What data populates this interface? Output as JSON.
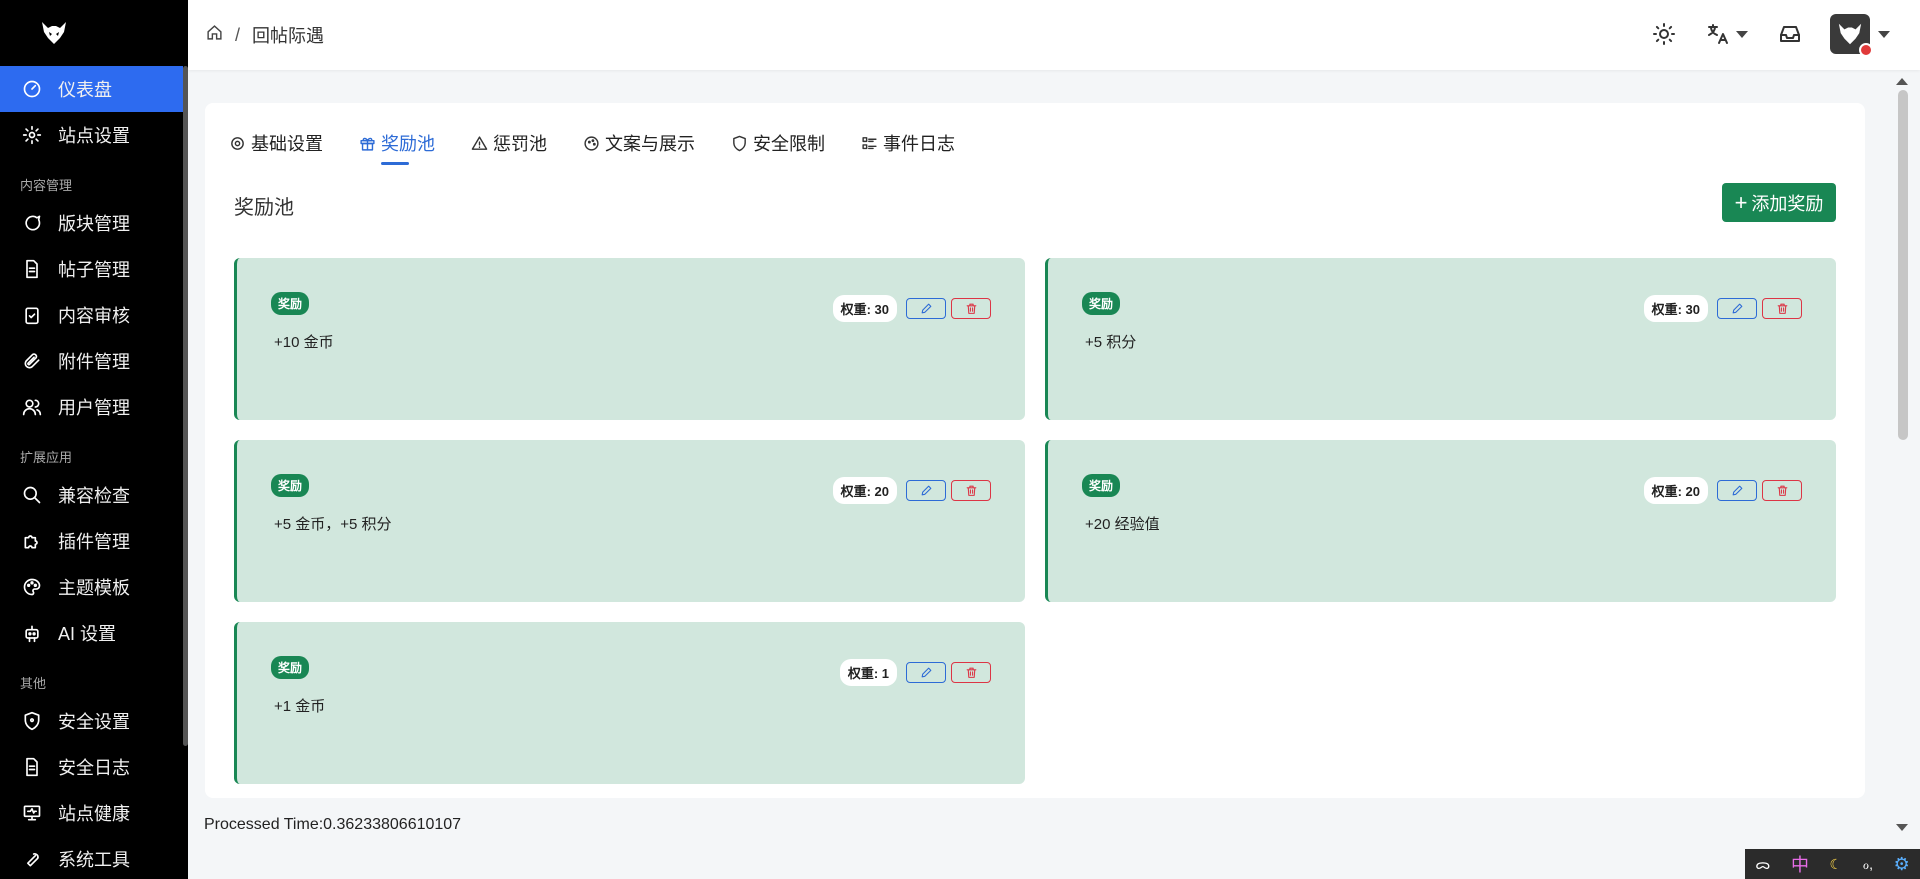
{
  "sidebar": {
    "items_top": [
      {
        "label": "仪表盘",
        "icon": "dashboard-icon",
        "active": true
      },
      {
        "label": "站点设置",
        "icon": "gear-icon",
        "active": false
      }
    ],
    "section_content": "内容管理",
    "items_content": [
      {
        "label": "版块管理",
        "icon": "chat-bubble-icon"
      },
      {
        "label": "帖子管理",
        "icon": "document-icon"
      },
      {
        "label": "内容审核",
        "icon": "clipboard-check-icon"
      },
      {
        "label": "附件管理",
        "icon": "paperclip-icon"
      },
      {
        "label": "用户管理",
        "icon": "users-icon"
      }
    ],
    "section_ext": "扩展应用",
    "items_ext": [
      {
        "label": "兼容检查",
        "icon": "search-icon"
      },
      {
        "label": "插件管理",
        "icon": "puzzle-icon"
      },
      {
        "label": "主题模板",
        "icon": "palette-icon"
      },
      {
        "label": "AI 设置",
        "icon": "robot-icon"
      }
    ],
    "section_other": "其他",
    "items_other": [
      {
        "label": "安全设置",
        "icon": "shield-icon"
      },
      {
        "label": "安全日志",
        "icon": "log-icon"
      },
      {
        "label": "站点健康",
        "icon": "monitor-icon"
      },
      {
        "label": "系统工具",
        "icon": "tool-icon"
      }
    ]
  },
  "header": {
    "breadcrumb_sep": "/",
    "breadcrumb_current": "回帖际遇"
  },
  "tabs": [
    {
      "label": "基础设置",
      "icon": "gear-icon",
      "active": false
    },
    {
      "label": "奖励池",
      "icon": "gift-icon",
      "active": true
    },
    {
      "label": "惩罚池",
      "icon": "warning-icon",
      "active": false
    },
    {
      "label": "文案与展示",
      "icon": "palette-icon",
      "active": false
    },
    {
      "label": "安全限制",
      "icon": "shield-icon",
      "active": false
    },
    {
      "label": "事件日志",
      "icon": "list-icon",
      "active": false
    }
  ],
  "pool": {
    "title": "奖励池",
    "add_label": "添加奖励",
    "rewards": [
      {
        "badge": "奖励",
        "text": "+10 金币",
        "weight": "权重: 30"
      },
      {
        "badge": "奖励",
        "text": "+5 积分",
        "weight": "权重: 30"
      },
      {
        "badge": "奖励",
        "text": "+5 金币，+5 积分",
        "weight": "权重: 20"
      },
      {
        "badge": "奖励",
        "text": "+20 经验值",
        "weight": "权重: 20"
      },
      {
        "badge": "奖励",
        "text": "+1 金币",
        "weight": "权重: 1"
      }
    ]
  },
  "footer": {
    "processed": "Processed Time:0.36233806610107"
  },
  "tray": {
    "lang": "中",
    "text_a": "ᯅ",
    "text_b": "ℴ,"
  },
  "colors": {
    "sidebar_bg": "#000000",
    "active_item": "#2d6bf0",
    "accent_green": "#198754",
    "reward_bg": "#d1e7dd",
    "tab_active": "#2d6bd6",
    "danger": "#dc3545"
  }
}
